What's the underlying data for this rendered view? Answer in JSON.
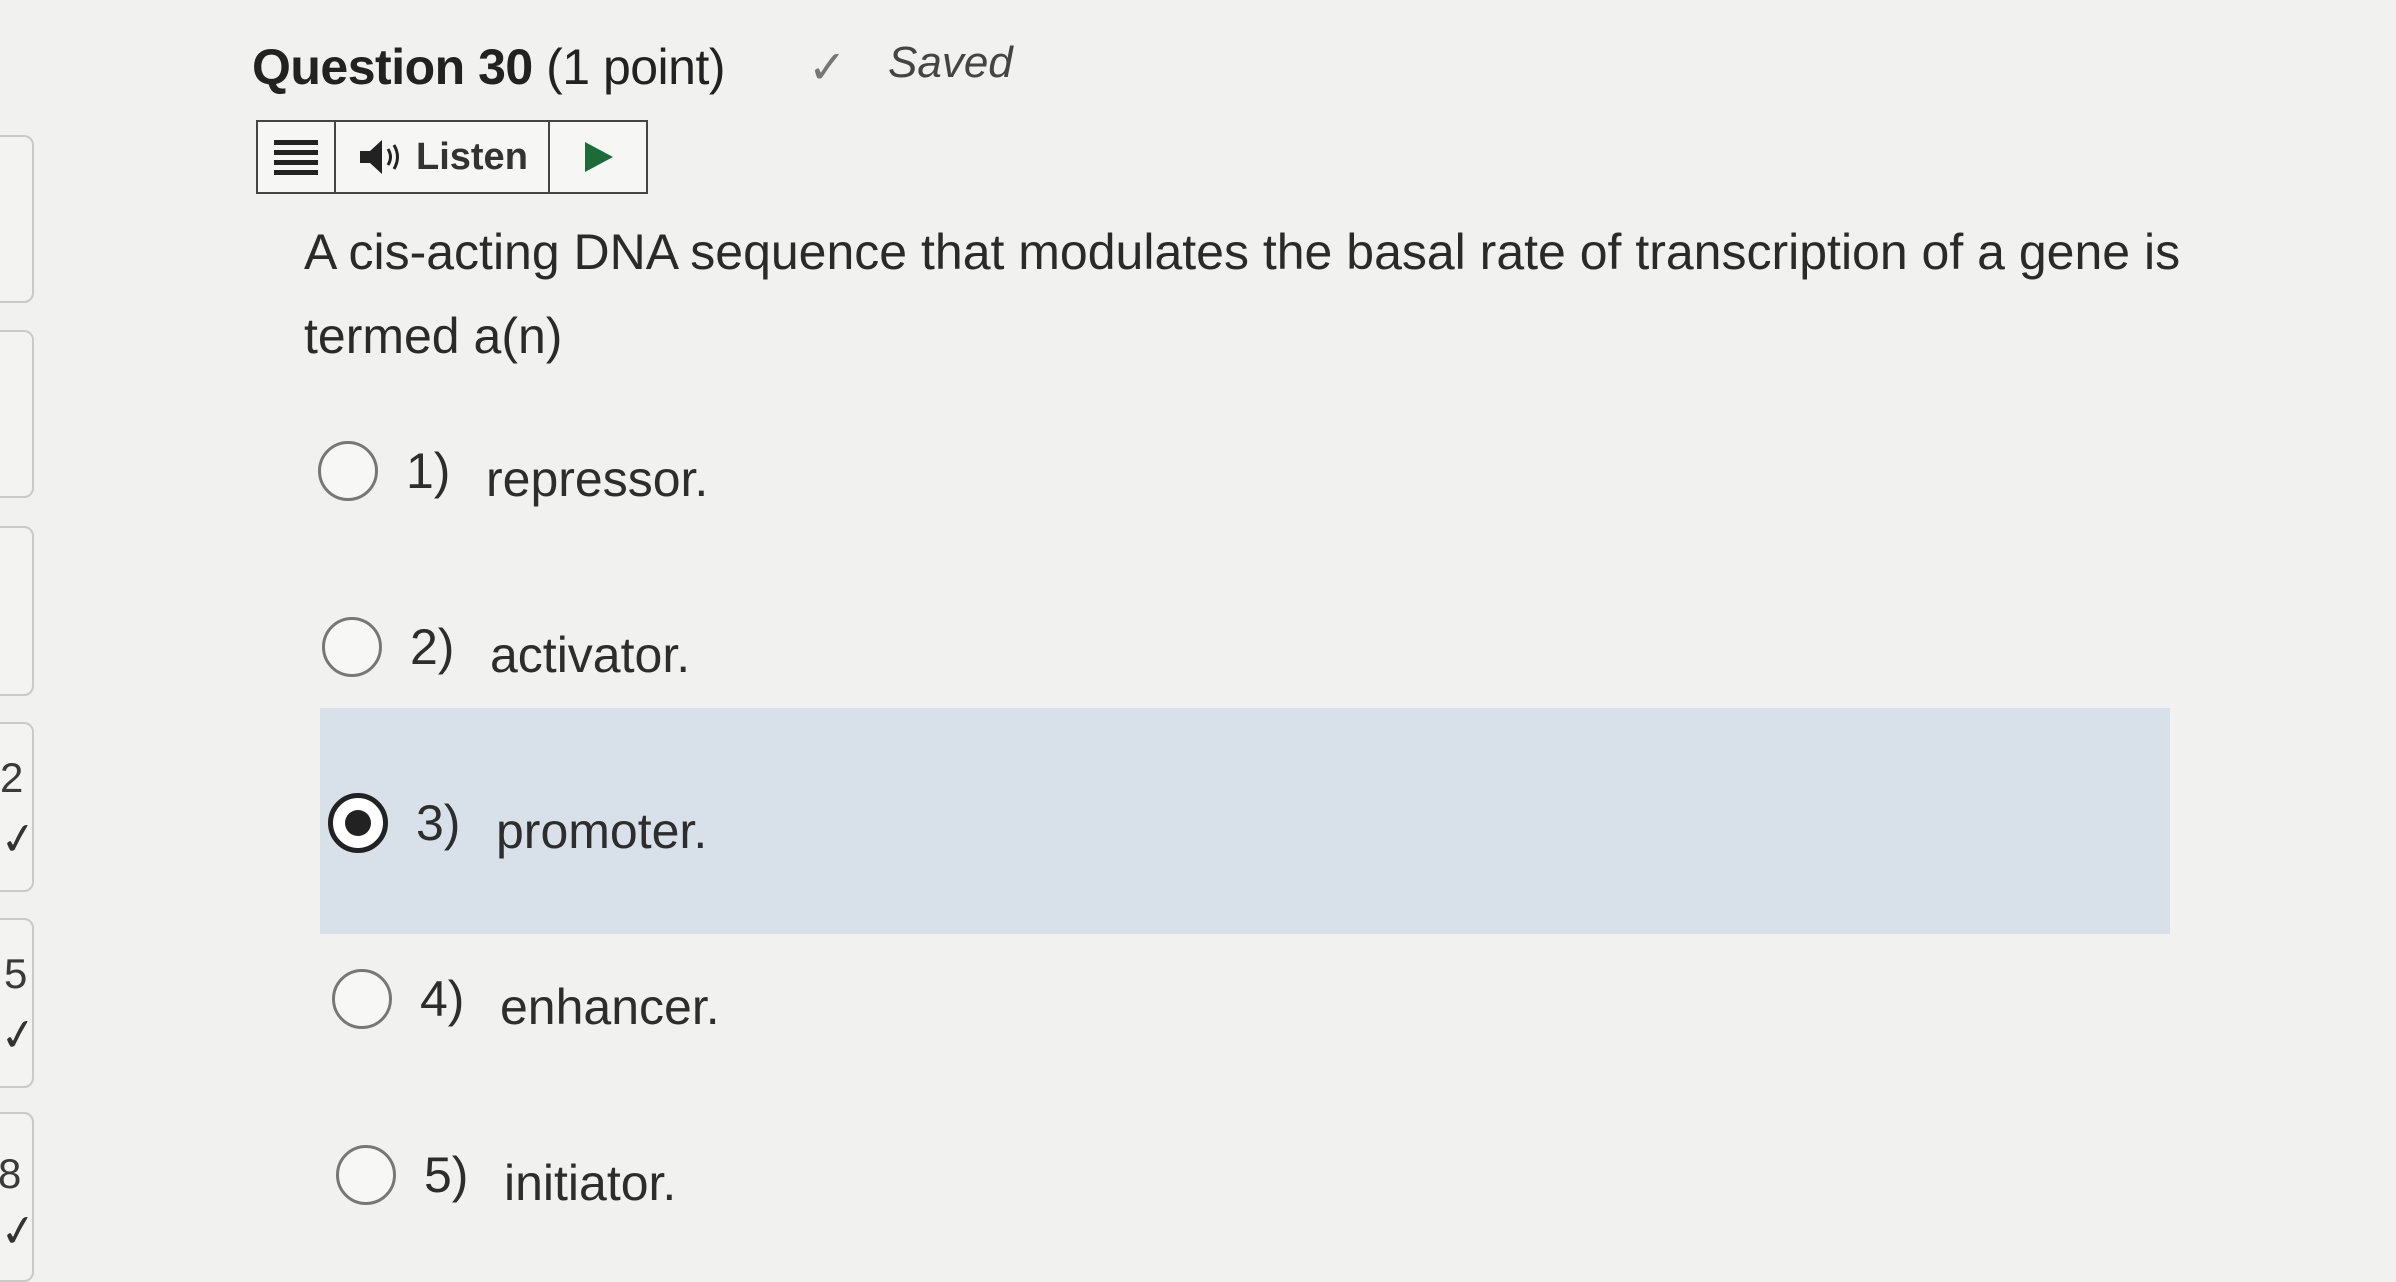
{
  "question": {
    "title": "Question 30",
    "points": "(1 point)",
    "saved_label": "Saved",
    "text": "A cis-acting DNA sequence that modulates the basal rate of transcription of a gene is termed a(n)"
  },
  "toolbar": {
    "listen_label": "Listen",
    "icons": [
      "menu-icon",
      "speaker-icon",
      "play-icon"
    ]
  },
  "options": [
    {
      "number": "1)",
      "label": "repressor.",
      "selected": false
    },
    {
      "number": "2)",
      "label": "activator.",
      "selected": false
    },
    {
      "number": "3)",
      "label": "promoter.",
      "selected": true
    },
    {
      "number": "4)",
      "label": "enhancer.",
      "selected": false
    },
    {
      "number": "5)",
      "label": "initiator.",
      "selected": false
    }
  ],
  "navigator": {
    "visible_numbers": [
      "2",
      "5",
      "8"
    ]
  },
  "colors": {
    "background": "#f1f1ef",
    "selected_highlight": "#d8e1ea",
    "text": "#2d2d2d"
  }
}
